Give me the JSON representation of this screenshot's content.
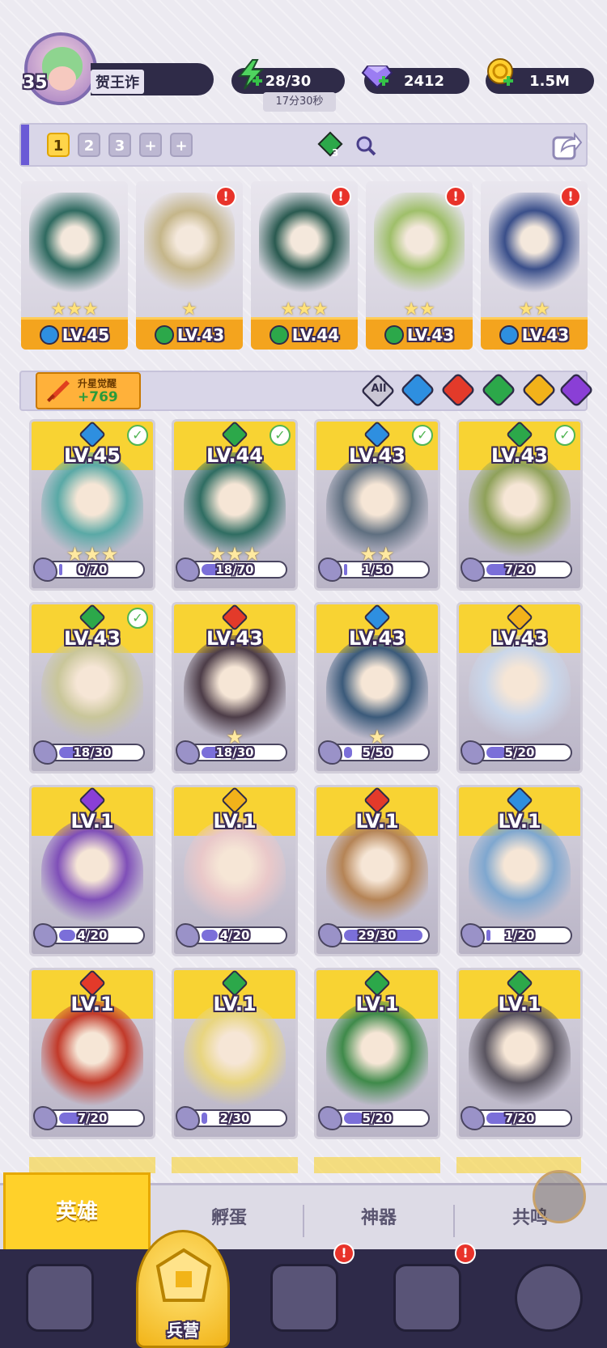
{
  "profile": {
    "level": "35",
    "name": "贺王诈"
  },
  "resources": {
    "energy": "28/30",
    "energy_timer": "17分30秒",
    "gems": "2412",
    "gold": "1.5M"
  },
  "team": {
    "tabs": [
      "1",
      "2",
      "3",
      "+",
      "+"
    ],
    "active_tab": "1",
    "token_count": "3",
    "heroes": [
      {
        "level": "LV.45",
        "element": "water",
        "stars": "★★★",
        "alert": false,
        "color": "#2f6a60"
      },
      {
        "level": "LV.43",
        "element": "nature",
        "stars": "★",
        "alert": true,
        "color": "#c5b68a"
      },
      {
        "level": "LV.44",
        "element": "nature",
        "stars": "★★★",
        "alert": true,
        "color": "#2a5a50"
      },
      {
        "level": "LV.43",
        "element": "nature",
        "stars": "★★",
        "alert": true,
        "color": "#9fbf6a"
      },
      {
        "level": "LV.43",
        "element": "water",
        "stars": "★★",
        "alert": true,
        "color": "#3a4f8a"
      }
    ]
  },
  "filter": {
    "star_up_label": "升星觉醒",
    "star_up_value": "+769",
    "all_label": "All",
    "elements": [
      "water",
      "fire",
      "nature",
      "light",
      "dark"
    ]
  },
  "colors": {
    "water": "#2e8fe0",
    "fire": "#e33a2a",
    "nature": "#2ca84a",
    "light": "#f2b21a",
    "dark": "#8a3fd6",
    "accent": "#ffd12a"
  },
  "roster": [
    {
      "level": "LV.45",
      "element": "water",
      "progress": "0/70",
      "ratio": 0.0,
      "check": true,
      "stars": "★★★",
      "color": "#5aa9a6"
    },
    {
      "level": "LV.44",
      "element": "nature",
      "progress": "18/70",
      "ratio": 0.26,
      "check": true,
      "stars": "★★★",
      "color": "#2f6d62"
    },
    {
      "level": "LV.43",
      "element": "water",
      "progress": "1/50",
      "ratio": 0.02,
      "check": true,
      "stars": "★★",
      "color": "#5f6f80"
    },
    {
      "level": "LV.43",
      "element": "nature",
      "progress": "7/20",
      "ratio": 0.35,
      "check": true,
      "stars": "",
      "color": "#8fa15a"
    },
    {
      "level": "LV.43",
      "element": "nature",
      "progress": "18/30",
      "ratio": 0.6,
      "check": true,
      "stars": "",
      "color": "#c9c69a"
    },
    {
      "level": "LV.43",
      "element": "fire",
      "progress": "18/30",
      "ratio": 0.6,
      "check": false,
      "stars": "★",
      "color": "#4d3d48"
    },
    {
      "level": "LV.43",
      "element": "water",
      "progress": "5/50",
      "ratio": 0.1,
      "check": false,
      "stars": "★",
      "color": "#3b5a7a"
    },
    {
      "level": "LV.43",
      "element": "light",
      "progress": "5/20",
      "ratio": 0.25,
      "check": false,
      "stars": "",
      "color": "#c9d6ea"
    },
    {
      "level": "LV.1",
      "element": "dark",
      "progress": "4/20",
      "ratio": 0.2,
      "check": false,
      "stars": "",
      "color": "#7f4fb8"
    },
    {
      "level": "LV.1",
      "element": "light",
      "progress": "4/20",
      "ratio": 0.2,
      "check": false,
      "stars": "",
      "color": "#e9c8c9"
    },
    {
      "level": "LV.1",
      "element": "fire",
      "progress": "29/30",
      "ratio": 0.97,
      "check": false,
      "stars": "",
      "color": "#b58456"
    },
    {
      "level": "LV.1",
      "element": "water",
      "progress": "1/20",
      "ratio": 0.05,
      "check": false,
      "stars": "",
      "color": "#7fa7cf"
    },
    {
      "level": "LV.1",
      "element": "fire",
      "progress": "7/20",
      "ratio": 0.35,
      "check": false,
      "stars": "",
      "color": "#c23a2a"
    },
    {
      "level": "LV.1",
      "element": "nature",
      "progress": "2/30",
      "ratio": 0.07,
      "check": false,
      "stars": "",
      "color": "#e8d580"
    },
    {
      "level": "LV.1",
      "element": "nature",
      "progress": "5/20",
      "ratio": 0.25,
      "check": false,
      "stars": "",
      "color": "#3f8a4a"
    },
    {
      "level": "LV.1",
      "element": "nature",
      "progress": "7/20",
      "ratio": 0.35,
      "check": false,
      "stars": "",
      "color": "#5a5560"
    }
  ],
  "tabs": {
    "heroes": "英雄",
    "hatch": "孵蛋",
    "artifact": "神器",
    "resonance": "共鸣"
  },
  "nav": {
    "barracks": "兵营",
    "alert_mark": "!"
  }
}
